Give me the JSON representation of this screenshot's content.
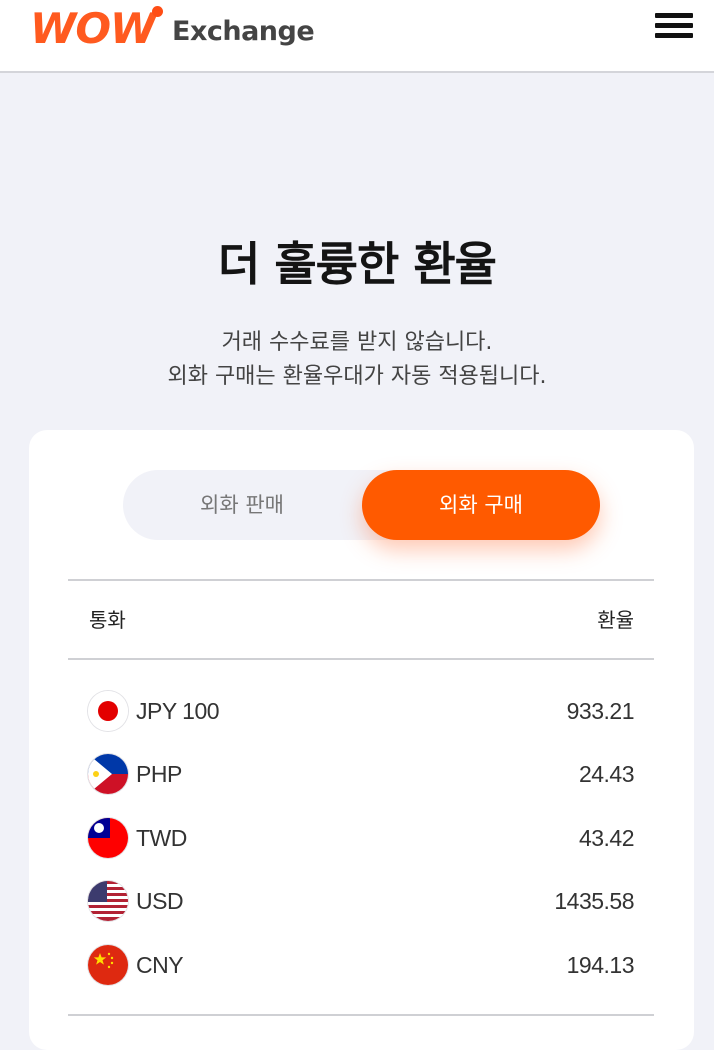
{
  "header": {
    "logo_wow": "WOW",
    "logo_exchange": "Exchange",
    "menu_icon": "hamburger-menu-icon",
    "brand_color": "#ff5a1f"
  },
  "hero": {
    "title": "더 훌륭한 환율",
    "desc_line1": "거래 수수료를 받지 않습니다.",
    "desc_line2": "외화 구매는 환율우대가 자동 적용됩니다."
  },
  "toggle": {
    "sell_label": "외화 판매",
    "buy_label": "외화 구매",
    "active": "buy",
    "active_color": "#ff5a00"
  },
  "table": {
    "col_currency": "통화",
    "col_rate": "환율",
    "rows": [
      {
        "code": "JPY 100",
        "rate": "933.21",
        "flag": "japan-flag-icon"
      },
      {
        "code": "PHP",
        "rate": "24.43",
        "flag": "philippines-flag-icon"
      },
      {
        "code": "TWD",
        "rate": "43.42",
        "flag": "taiwan-flag-icon"
      },
      {
        "code": "USD",
        "rate": "1435.58",
        "flag": "usa-flag-icon"
      },
      {
        "code": "CNY",
        "rate": "194.13",
        "flag": "china-flag-icon"
      }
    ]
  }
}
